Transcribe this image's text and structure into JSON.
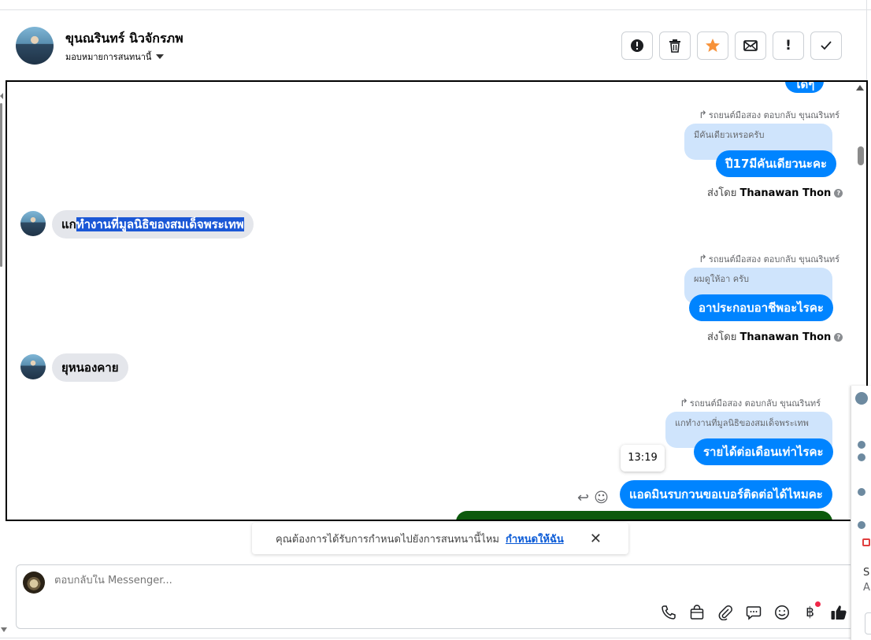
{
  "header": {
    "contact_name": "ขุนณรินทร์ นิวจักรภพ",
    "assign_label": "มอบหมายการสนทนานี้",
    "actions": [
      {
        "icon": "alert-circle-icon",
        "glyph": "!"
      },
      {
        "icon": "trash-icon",
        "glyph": "🗑"
      },
      {
        "icon": "star-icon",
        "glyph": "★",
        "color": "#f7923a"
      },
      {
        "icon": "mail-icon",
        "glyph": "✉"
      },
      {
        "icon": "exclamation-icon",
        "glyph": "!"
      },
      {
        "icon": "check-icon",
        "glyph": "✓"
      }
    ]
  },
  "messages": {
    "top_partial": "ได้ๆ",
    "group1": {
      "reply_meta": "รถยนต์มือสอง ตอบกลับ ขุนณรินทร์",
      "quoted": "มีคันเดียวเหรอครับ",
      "text": "ปี17มีคันเดียวนะคะ",
      "sent_by_label": "ส่งโดย",
      "sent_by_name": "Thanawan Thon"
    },
    "incoming1": {
      "prefix": "แก",
      "highlighted": "ทำงานที่มูลนิธิของสมเด็จพระเทพ"
    },
    "group2": {
      "reply_meta": "รถยนต์มือสอง ตอบกลับ ขุนณรินทร์",
      "quoted": "ผมดูให้อา ครับ",
      "text": "อาประกอบอาชีพอะไรคะ",
      "sent_by_label": "ส่งโดย",
      "sent_by_name": "Thanawan Thon"
    },
    "incoming2": {
      "text": "ยุหนองคาย"
    },
    "group3": {
      "reply_meta": "รถยนต์มือสอง ตอบกลับ ขุนณรินทร์",
      "quoted": "แกทำงานที่มูลนิธิของสมเด็จพระเทพ",
      "text": "รายได้ต่อเดือนเท่าไรคะ"
    },
    "timestamp": "13:19",
    "last": {
      "text": "แอดมินรบกวนขอเบอร์ติดต่อได้ไหมคะ"
    },
    "colors": {
      "outgoing": "#0084ff",
      "incoming": "#e4e6eb",
      "quote": "#cfe4fc"
    }
  },
  "suggestion": {
    "text": "คุณต้องการได้รับการกำหนดไปยังการสนทนานี้ไหม",
    "link": "กำหนดให้ฉัน"
  },
  "composer": {
    "placeholder": "ตอบกลับใน Messenger...",
    "tools": [
      {
        "icon": "phone-icon",
        "glyph": "✆"
      },
      {
        "icon": "shopping-bag-icon",
        "glyph": "⊡"
      },
      {
        "icon": "paperclip-icon",
        "glyph": "⌇"
      },
      {
        "icon": "saved-replies-icon",
        "glyph": "▭"
      },
      {
        "icon": "emoji-icon",
        "glyph": "☺"
      },
      {
        "icon": "baht-icon",
        "glyph": "฿"
      },
      {
        "icon": "thumbs-up-icon",
        "glyph": "👍"
      }
    ]
  },
  "side_panel": {
    "text_a": "S",
    "text_b": "A"
  }
}
